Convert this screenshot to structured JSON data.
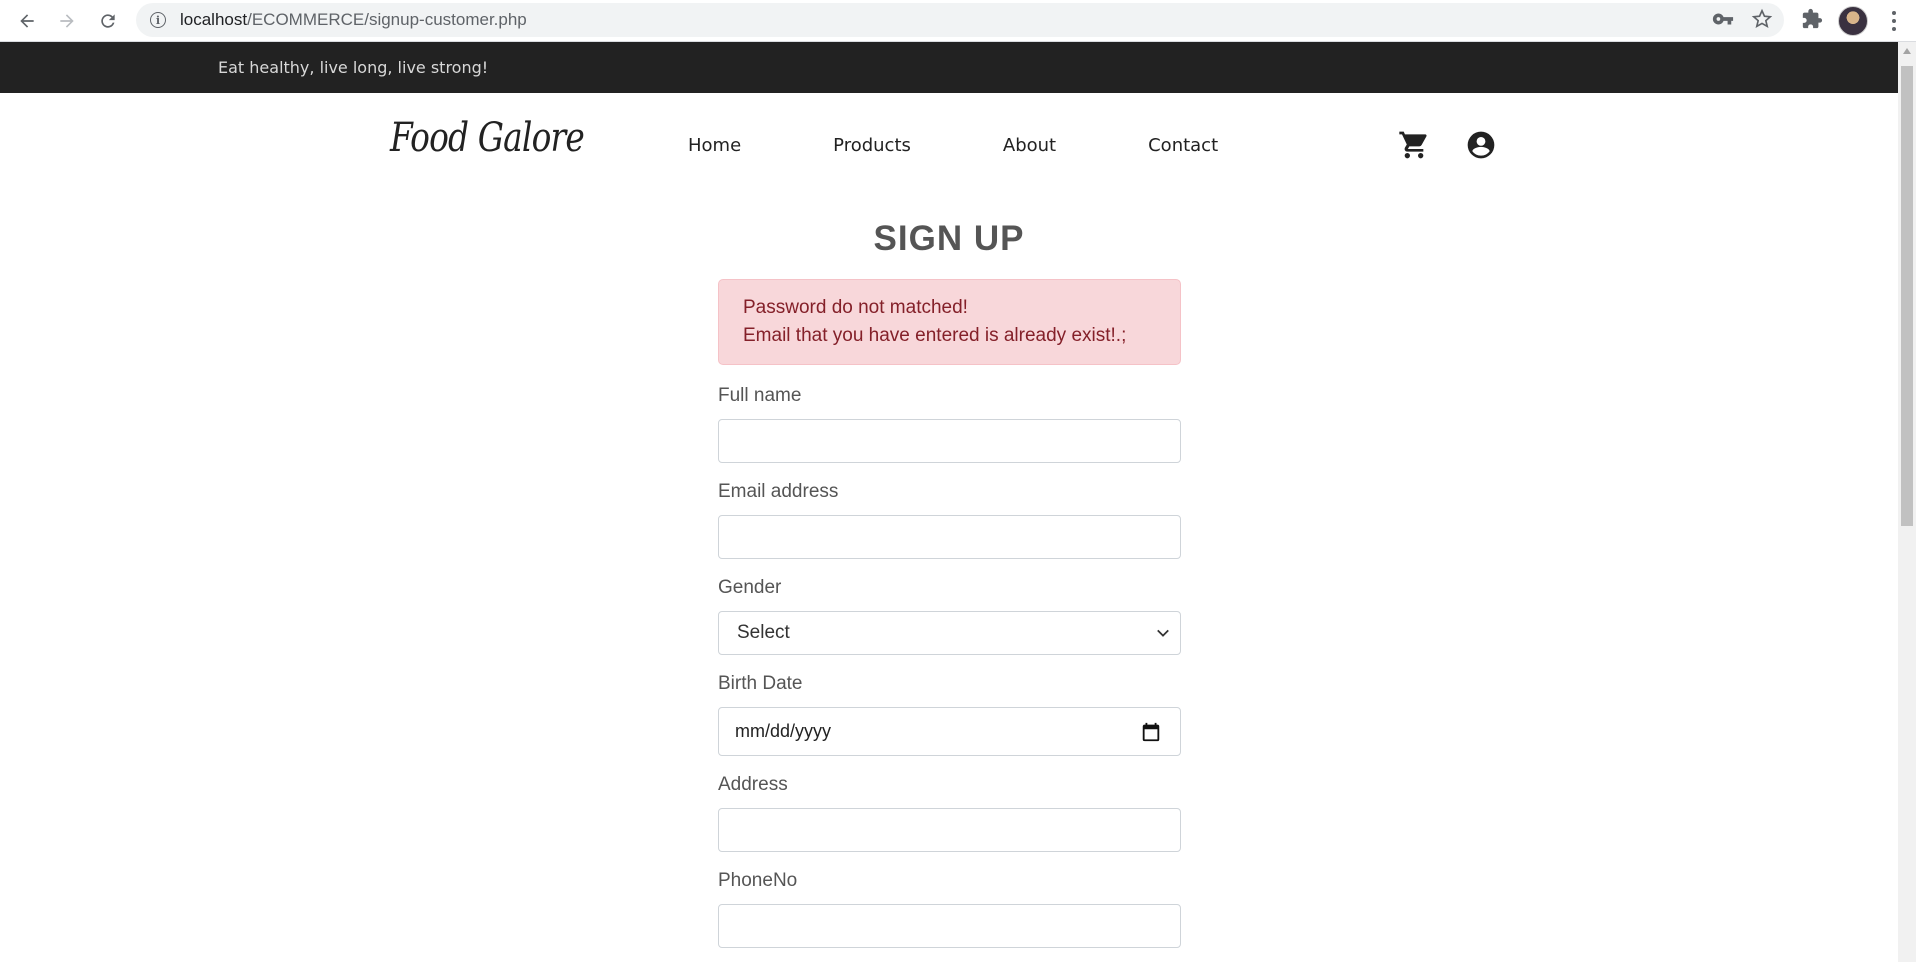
{
  "browser": {
    "url_host": "localhost",
    "url_path": "/ECOMMERCE/signup-customer.php"
  },
  "topbar": {
    "tagline": "Eat healthy, live long, live strong!"
  },
  "header": {
    "logo": "Food Galore",
    "menu": [
      "Home",
      "Products",
      "About",
      "Contact"
    ]
  },
  "signup": {
    "title": "SIGN UP",
    "errors": [
      "Password do not matched!",
      "Email that you have entered is already exist!.;"
    ],
    "fields": {
      "fullname_label": "Full name",
      "email_label": "Email address",
      "gender_label": "Gender",
      "gender_selected": "Select",
      "birthdate_label": "Birth Date",
      "birthdate_placeholder": "mm/dd/yyyy",
      "address_label": "Address",
      "phone_label": "PhoneNo"
    }
  },
  "colors": {
    "topbar_bg": "#222222",
    "alert_bg": "#f8d7da",
    "alert_text": "#842029"
  }
}
